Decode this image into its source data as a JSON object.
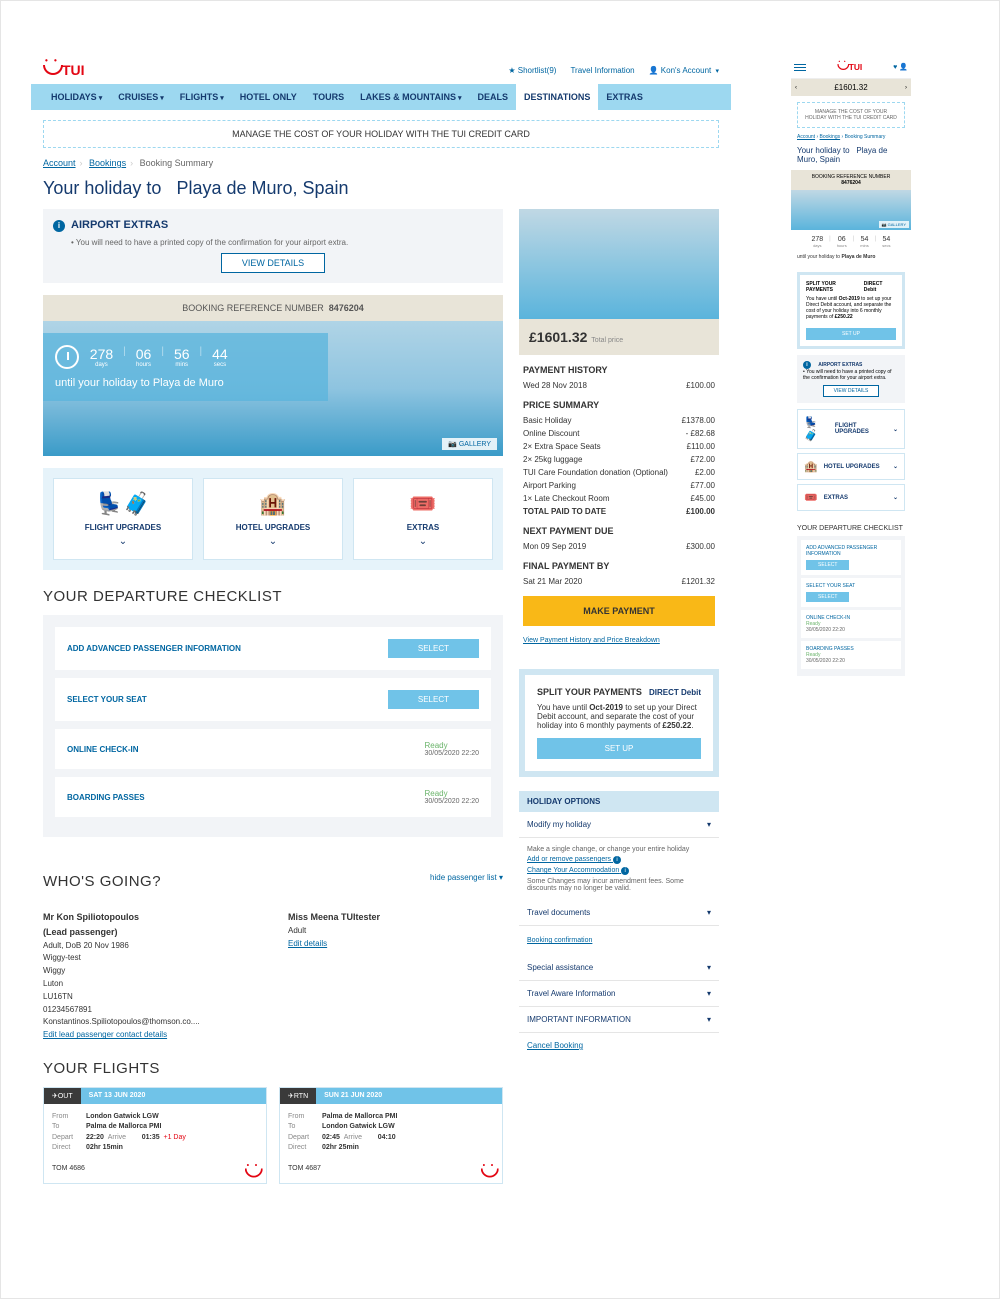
{
  "brand": "TUI",
  "topLinks": {
    "shortlist": "Shortlist(9)",
    "travel": "Travel Information",
    "account": "Kon's Account"
  },
  "nav": [
    "HOLIDAYS",
    "CRUISES",
    "FLIGHTS",
    "HOTEL ONLY",
    "TOURS",
    "LAKES & MOUNTAINS",
    "DEALS",
    "DESTINATIONS",
    "EXTRAS"
  ],
  "promo": "MANAGE THE COST OF YOUR HOLIDAY WITH THE TUI CREDIT CARD",
  "breadcrumb": {
    "a": "Account",
    "b": "Bookings",
    "c": "Booking Summary"
  },
  "pageTitlePrefix": "Your holiday to",
  "destination": "Playa de Muro, Spain",
  "destinationShort": "Playa de Muro",
  "airportExtras": {
    "heading": "AIRPORT EXTRAS",
    "text": "You will need to have a printed copy of the confirmation for your airport extra.",
    "button": "VIEW DETAILS"
  },
  "referenceLabel": "BOOKING REFERENCE NUMBER",
  "referenceNumber": "8476204",
  "countdown": {
    "days": "278",
    "daysL": "days",
    "hours": "06",
    "hoursL": "hours",
    "mins": "56",
    "minsL": "mins",
    "secs": "44",
    "secsL": "secs",
    "mMins": "54",
    "mSecs": "54",
    "text": "until your holiday to Playa de Muro"
  },
  "gallery": "GALLERY",
  "tiles": {
    "flight": "FLIGHT UPGRADES",
    "hotel": "HOTEL UPGRADES",
    "extras": "EXTRAS"
  },
  "checklistHeading": "YOUR DEPARTURE CHECKLIST",
  "checklist": [
    {
      "label": "ADD ADVANCED PASSENGER INFORMATION",
      "action": "select"
    },
    {
      "label": "SELECT YOUR SEAT",
      "action": "select"
    },
    {
      "label": "ONLINE CHECK-IN",
      "status": "Ready",
      "date": "30/05/2020 22:20"
    },
    {
      "label": "BOARDING PASSES",
      "status": "Ready",
      "date": "30/05/2020 22:20"
    }
  ],
  "selectLabel": "SELECT",
  "whoHeading": "WHO'S GOING?",
  "hidePax": "hide passenger list",
  "passengers": {
    "lead": {
      "name": "Mr Kon Spiliotopoulos",
      "role": "(Lead passenger)",
      "dob": "Adult, DoB 20 Nov 1986",
      "l1": "Wiggy-test",
      "l2": "Wiggy",
      "l3": "Luton",
      "l4": "LU16TN",
      "l5": "01234567891",
      "l6": "Konstantinos.Spiliotopoulos@thomson.co....",
      "edit": "Edit lead passenger contact details"
    },
    "other": {
      "name": "Miss Meena TUItester",
      "role": "Adult",
      "edit": "Edit details"
    }
  },
  "flightsHeading": "YOUR FLIGHTS",
  "flights": {
    "out": {
      "dir": "✈OUT",
      "date": "SAT 13 JUN 2020",
      "from": "London Gatwick LGW",
      "to": "Palma de Mallorca PMI",
      "dep": "22:20",
      "arr": "01:35",
      "dur": "02hr 15min",
      "plus": "+1 Day",
      "code": "TOM 4686"
    },
    "rtn": {
      "dir": "✈RTN",
      "date": "SUN 21 JUN 2020",
      "from": "Palma de Mallorca PMI",
      "to": "London Gatwick LGW",
      "dep": "02:45",
      "arr": "04:10",
      "dur": "02hr 25min",
      "code": "TOM 4687"
    },
    "lbl": {
      "from": "From",
      "to": "To",
      "depart": "Depart",
      "arrive": "Arrive",
      "direct": "Direct"
    }
  },
  "price": {
    "total": "£1601.32",
    "label": "Total price"
  },
  "paymentHistory": {
    "h": "PAYMENT HISTORY",
    "date": "Wed 28 Nov 2018",
    "amount": "£100.00"
  },
  "priceSummary": {
    "h": "PRICE SUMMARY",
    "rows": [
      [
        "Basic Holiday",
        "£1378.00"
      ],
      [
        "Online Discount",
        "- £82.68"
      ],
      [
        "2× Extra Space Seats",
        "£110.00"
      ],
      [
        "2× 25kg luggage",
        "£72.00"
      ],
      [
        "TUI Care Foundation donation (Optional)",
        "£2.00"
      ],
      [
        "Airport Parking",
        "£77.00"
      ],
      [
        "1× Late Checkout Room",
        "£45.00"
      ]
    ],
    "totalLabel": "TOTAL PAID TO DATE",
    "totalVal": "£100.00"
  },
  "nextPayment": {
    "h": "NEXT PAYMENT DUE",
    "date": "Mon 09 Sep 2019",
    "amount": "£300.00"
  },
  "finalPayment": {
    "h": "FINAL PAYMENT BY",
    "date": "Sat 21 Mar 2020",
    "amount": "£1201.32"
  },
  "makePayment": "MAKE PAYMENT",
  "viewHistory": "View Payment History and Price Breakdown",
  "split": {
    "h": "SPLIT YOUR PAYMENTS",
    "logo": "DIRECT Debit",
    "t1": "You have until ",
    "deadline": "Oct-2019",
    "t2": " to set up your Direct Debit account, and separate the cost of your holiday into 6 monthly payments of ",
    "amount": "£250.22",
    "t3": ".",
    "btn": "SET UP"
  },
  "holidayOptions": {
    "h": "HOLIDAY OPTIONS",
    "modify": "Modify my holiday",
    "modifyText": "Make a single change, or change your entire holiday",
    "link1": "Add or remove passengers",
    "link2": "Change Your Accommodation",
    "note": "Some Changes may incur amendment fees. Some discounts may no longer be valid.",
    "items": [
      "Travel documents",
      "Special assistance",
      "Travel Aware Information",
      "IMPORTANT INFORMATION"
    ],
    "sub": "Booking confirmation",
    "cancel": "Cancel Booking"
  }
}
